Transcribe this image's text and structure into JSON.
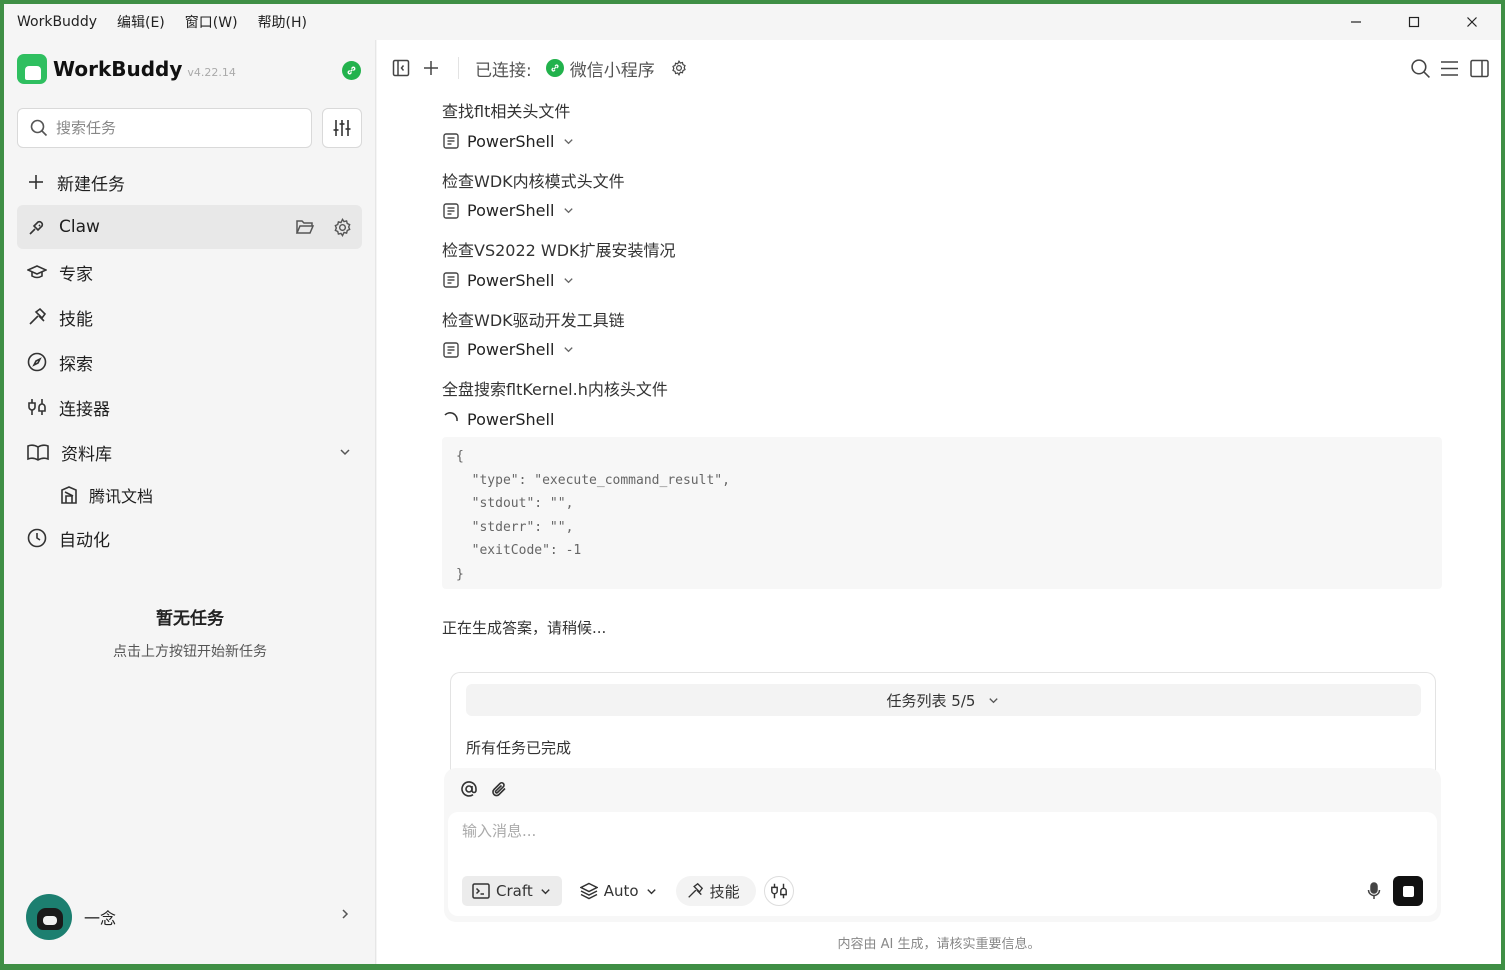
{
  "menu": [
    "WorkBuddy",
    "编辑(E)",
    "窗口(W)",
    "帮助(H)"
  ],
  "brand": {
    "name": "WorkBuddy",
    "version": "v4.22.14"
  },
  "search": {
    "placeholder": "搜索任务"
  },
  "nav": {
    "new_task": "新建任务",
    "claw": "Claw",
    "expert": "专家",
    "skills": "技能",
    "explore": "探索",
    "connectors": "连接器",
    "library": "资料库",
    "tencent_docs": "腾讯文档",
    "automation": "自动化"
  },
  "empty": {
    "title": "暂无任务",
    "subtitle": "点击上方按钮开始新任务"
  },
  "user": {
    "name": "一念"
  },
  "toolbar": {
    "connected_label": "已连接:",
    "connector_name": "微信小程序"
  },
  "steps": [
    {
      "title": "查找flt相关头文件",
      "tool": "PowerShell",
      "status": "done"
    },
    {
      "title": "检查WDK内核模式头文件",
      "tool": "PowerShell",
      "status": "done"
    },
    {
      "title": "检查VS2022 WDK扩展安装情况",
      "tool": "PowerShell",
      "status": "done"
    },
    {
      "title": "检查WDK驱动开发工具链",
      "tool": "PowerShell",
      "status": "done"
    },
    {
      "title": "全盘搜索fltKernel.h内核头文件",
      "tool": "PowerShell",
      "status": "running"
    }
  ],
  "code_output": "{\n  \"type\": \"execute_command_result\",\n  \"stdout\": \"\",\n  \"stderr\": \"\",\n  \"exitCode\": -1\n}",
  "generating_text": "正在生成答案，请稍候...",
  "task_list": {
    "header": "任务列表 5/5",
    "status": "所有任务已完成"
  },
  "composer": {
    "placeholder": "输入消息...",
    "mode": "Craft",
    "model": "Auto",
    "skills_label": "技能"
  },
  "disclaimer": "内容由 AI 生成，请核实重要信息。",
  "colors": {
    "accent_green": "#22b24c",
    "window_border": "#3f8f45"
  }
}
